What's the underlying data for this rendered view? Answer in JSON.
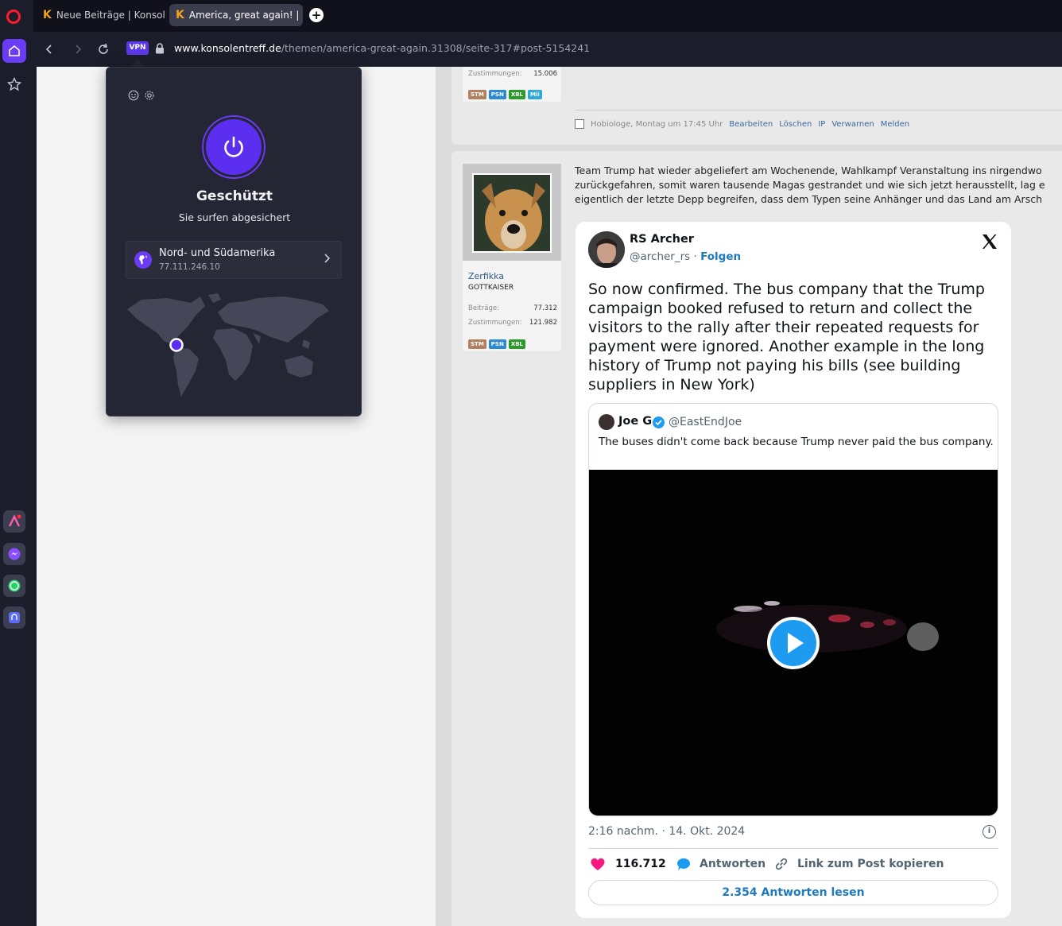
{
  "browser": {
    "tabs": [
      {
        "icon": "K",
        "title": "Neue Beiträge | Konsolent"
      },
      {
        "icon": "K",
        "title": "America, great again! | Ser"
      }
    ],
    "new_tab_label": "+",
    "vpn_badge": "VPN",
    "url_domain": "www.konsolentreff.de",
    "url_path": "/themen/america-great-again.31308/seite-317#post-5154241"
  },
  "vpn_popup": {
    "status": "Geschützt",
    "subtitle": "Sie surfen abgesichert",
    "location_name": "Nord- und Südamerika",
    "location_ip": "77.111.246.10",
    "accent": "#5b2ef0"
  },
  "post1": {
    "stat_label": "Zustimmungen:",
    "stat_value": "15.006",
    "badges": [
      "STM",
      "PSN",
      "XBL",
      "Mii"
    ],
    "meta": "Hobiologe, Montag um 17:45 Uhr",
    "actions": [
      "Bearbeiten",
      "Löschen",
      "IP",
      "Verwarnen",
      "Melden"
    ]
  },
  "post2": {
    "username": "Zerfikka",
    "usertitle": "GOTTKAISER",
    "posts_label": "Beiträge:",
    "posts_value": "77.312",
    "likes_label": "Zustimmungen:",
    "likes_value": "121.982",
    "badges": [
      "STM",
      "PSN",
      "XBL"
    ],
    "text_lines": [
      "Team Trump hat wieder abgeliefert am Wochenende, Wahlkampf Veranstaltung ins nirgendwo",
      "zurückgefahren, somit waren tausende Magas gestrandet und wie sich jetzt herausstellt, lag e",
      "eigentlich der letzte Depp begreifen, dass dem Typen seine Anhänger und das Land am Arsch"
    ]
  },
  "tweet": {
    "author_name": "RS Archer",
    "author_handle": "@archer_rs",
    "follow_label": "Folgen",
    "separator": "·",
    "text": "So now confirmed. The bus company that the Trump campaign booked refused to return and collect the visitors to the rally after their repeated requests for payment were ignored.  Another example in the long history of Trump not paying his bills (see building suppliers in New York)",
    "quote": {
      "name": "Joe G",
      "handle": "@EastEndJoe",
      "text": "The buses didn't come back because Trump never paid the bus company."
    },
    "timestamp": "2:16 nachm. · 14. Okt. 2024",
    "likes": "116.712",
    "reply_label": "Antworten",
    "copy_label": "Link zum Post kopieren",
    "read_replies": "2.354 Antworten lesen",
    "like_color": "#f91880",
    "link_color": "#1d7ac0"
  },
  "icons": {
    "sidebar": [
      "opera-logo",
      "home-icon",
      "star-icon",
      "aria-icon",
      "messenger-icon",
      "whatsapp-icon",
      "music-icon"
    ],
    "vpn_popup": [
      "smiley-icon",
      "gear-icon",
      "power-icon",
      "globe-icon",
      "chevron-right-icon"
    ],
    "tweet": [
      "x-logo",
      "verified-icon",
      "play-icon",
      "info-icon",
      "heart-icon",
      "reply-icon",
      "link-icon"
    ]
  }
}
